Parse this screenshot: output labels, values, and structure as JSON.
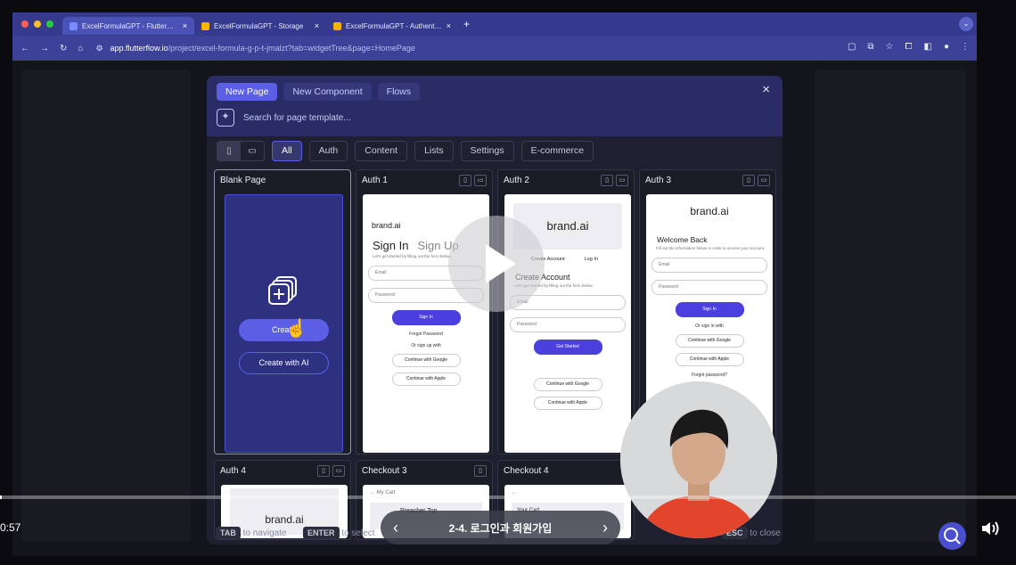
{
  "browser": {
    "tabs": [
      {
        "label": "ExcelFormulaGPT - FlutterFlow",
        "favicon_color": "#7b8cff",
        "active": true
      },
      {
        "label": "ExcelFormulaGPT - Storage",
        "favicon_color": "#f4b400",
        "active": false
      },
      {
        "label": "ExcelFormulaGPT - Authentication",
        "favicon_color": "#f4b400",
        "active": false
      }
    ],
    "tab_close": "×",
    "new_tab": "+",
    "url_host": "app.flutterflow.io",
    "url_path": "/project/excel-formula-g-p-t-jmalzt?tab=widgetTree&page=HomePage"
  },
  "modal": {
    "top_tabs": [
      "New Page",
      "New Component",
      "Flows"
    ],
    "close": "×",
    "search_placeholder": "Search for page template...",
    "filters": [
      "All",
      "Auth",
      "Content",
      "Lists",
      "Settings",
      "E-commerce"
    ],
    "cards": {
      "blank": {
        "title": "Blank Page",
        "create": "Create",
        "create_ai": "Create with AI"
      },
      "auth1": {
        "title": "Auth 1",
        "brand": "brand.ai",
        "heading_a": "Sign In",
        "heading_b": "Sign Up",
        "sub": "Let's get started by filling out the form below.",
        "email": "Email",
        "password": "Password",
        "btn": "Sign In",
        "forgot": "Forgot Password",
        "or": "Or sign up with",
        "google": "Continue with Google",
        "apple": "Continue with Apple"
      },
      "auth2": {
        "title": "Auth 2",
        "brand": "brand.ai",
        "tab_a": "Create Account",
        "tab_b": "Log In",
        "heading": "Create Account",
        "sub": "Let's get started by filling out the form below.",
        "email": "Email",
        "password": "Password",
        "btn": "Get Started",
        "google": "Continue with Google",
        "apple": "Continue with Apple"
      },
      "auth3": {
        "title": "Auth 3",
        "brand": "brand.ai",
        "heading": "Welcome Back",
        "sub": "Fill out the information below in order to access your account.",
        "email": "Email",
        "password": "Password",
        "btn": "Sign In",
        "or": "Or sign in with",
        "google": "Continue with Google",
        "apple": "Continue with Apple",
        "forgot": "Forgot password?"
      },
      "auth4": {
        "title": "Auth 4",
        "brand": "brand.ai"
      },
      "checkout3": {
        "title": "Checkout 3",
        "back": "My Cart",
        "item": "Preacher Top"
      },
      "checkout4": {
        "title": "Checkout 4",
        "item": "Your Cart"
      }
    },
    "footer": {
      "tab_key": "TAB",
      "tab_text": "to navigate",
      "enter_key": "ENTER",
      "enter_text": "to select",
      "esc_key": "ESC",
      "esc_text": "to close"
    }
  },
  "player": {
    "time": "0:57",
    "progress": 0.0,
    "chapter_title": "2-4. 로그인과 회원가입",
    "prev": "‹",
    "next": "›",
    "volume_icon": "🔊"
  }
}
